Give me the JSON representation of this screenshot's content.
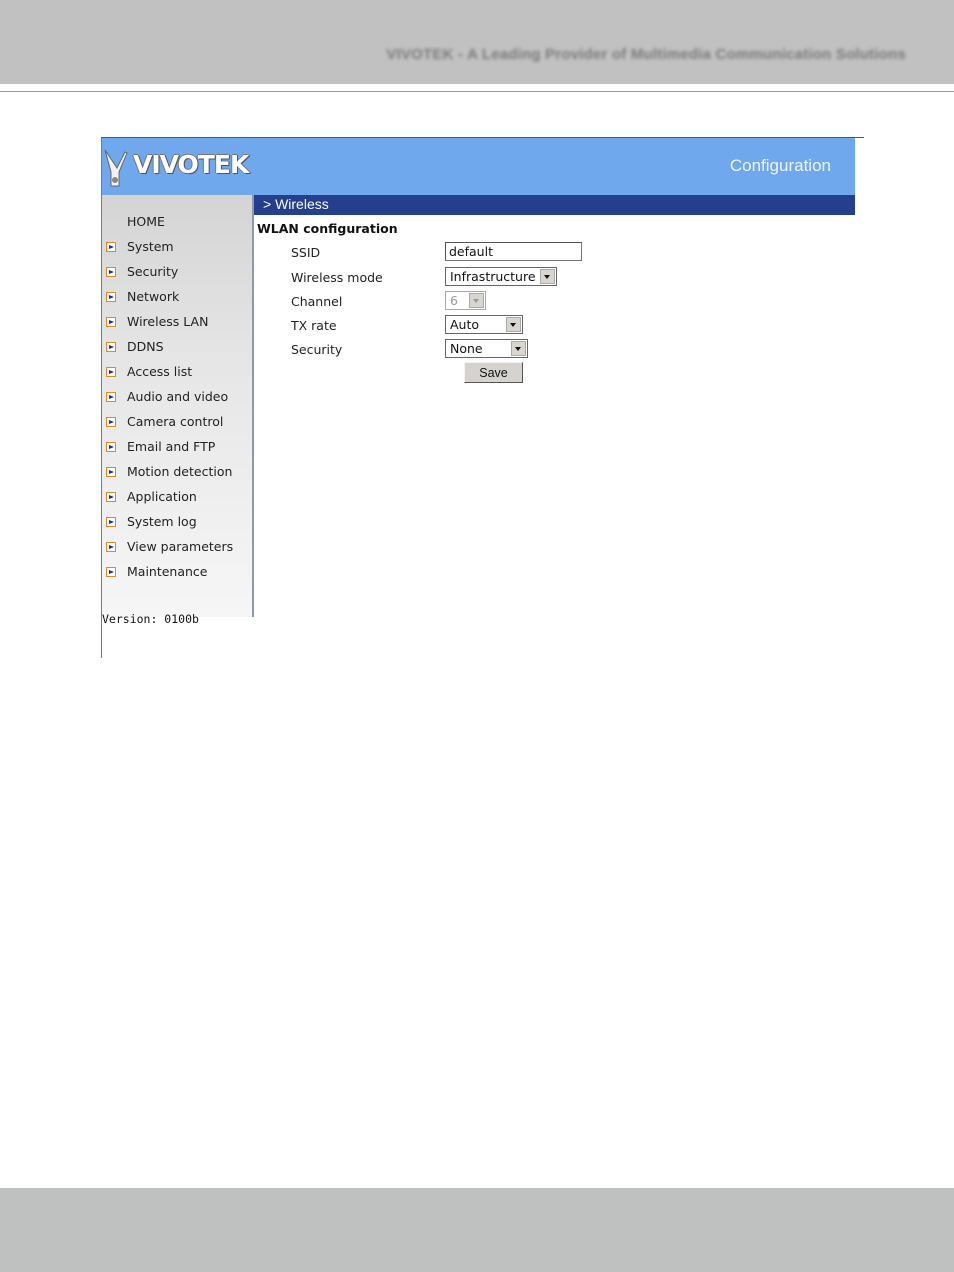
{
  "document": {
    "header_text": "VIVOTEK - A Leading Provider of Multimedia Communication Solutions"
  },
  "app": {
    "logo_text": "VIVOTEK",
    "title": "Configuration"
  },
  "sidebar": {
    "home_label": "HOME",
    "items": [
      {
        "label": "System"
      },
      {
        "label": "Security"
      },
      {
        "label": "Network"
      },
      {
        "label": "Wireless LAN"
      },
      {
        "label": "DDNS"
      },
      {
        "label": "Access list"
      },
      {
        "label": "Audio and video"
      },
      {
        "label": "Camera control"
      },
      {
        "label": "Email and FTP"
      },
      {
        "label": "Motion detection"
      },
      {
        "label": "Application"
      },
      {
        "label": "System log"
      },
      {
        "label": "View parameters"
      },
      {
        "label": "Maintenance"
      }
    ],
    "version": "Version: 0100b"
  },
  "breadcrumb": {
    "text": "> Wireless"
  },
  "main": {
    "section_title": "WLAN configuration",
    "fields": {
      "ssid": {
        "label": "SSID",
        "value": "default"
      },
      "wireless_mode": {
        "label": "Wireless mode",
        "value": "Infrastructure"
      },
      "channel": {
        "label": "Channel",
        "value": "6",
        "disabled": true
      },
      "tx_rate": {
        "label": "TX rate",
        "value": "Auto"
      },
      "security": {
        "label": "Security",
        "value": "None"
      }
    },
    "save_label": "Save"
  },
  "colors": {
    "banner": "#6fa8ed",
    "breadcrumb_bar": "#253f8e",
    "doc_band": "#c0c1c0"
  }
}
